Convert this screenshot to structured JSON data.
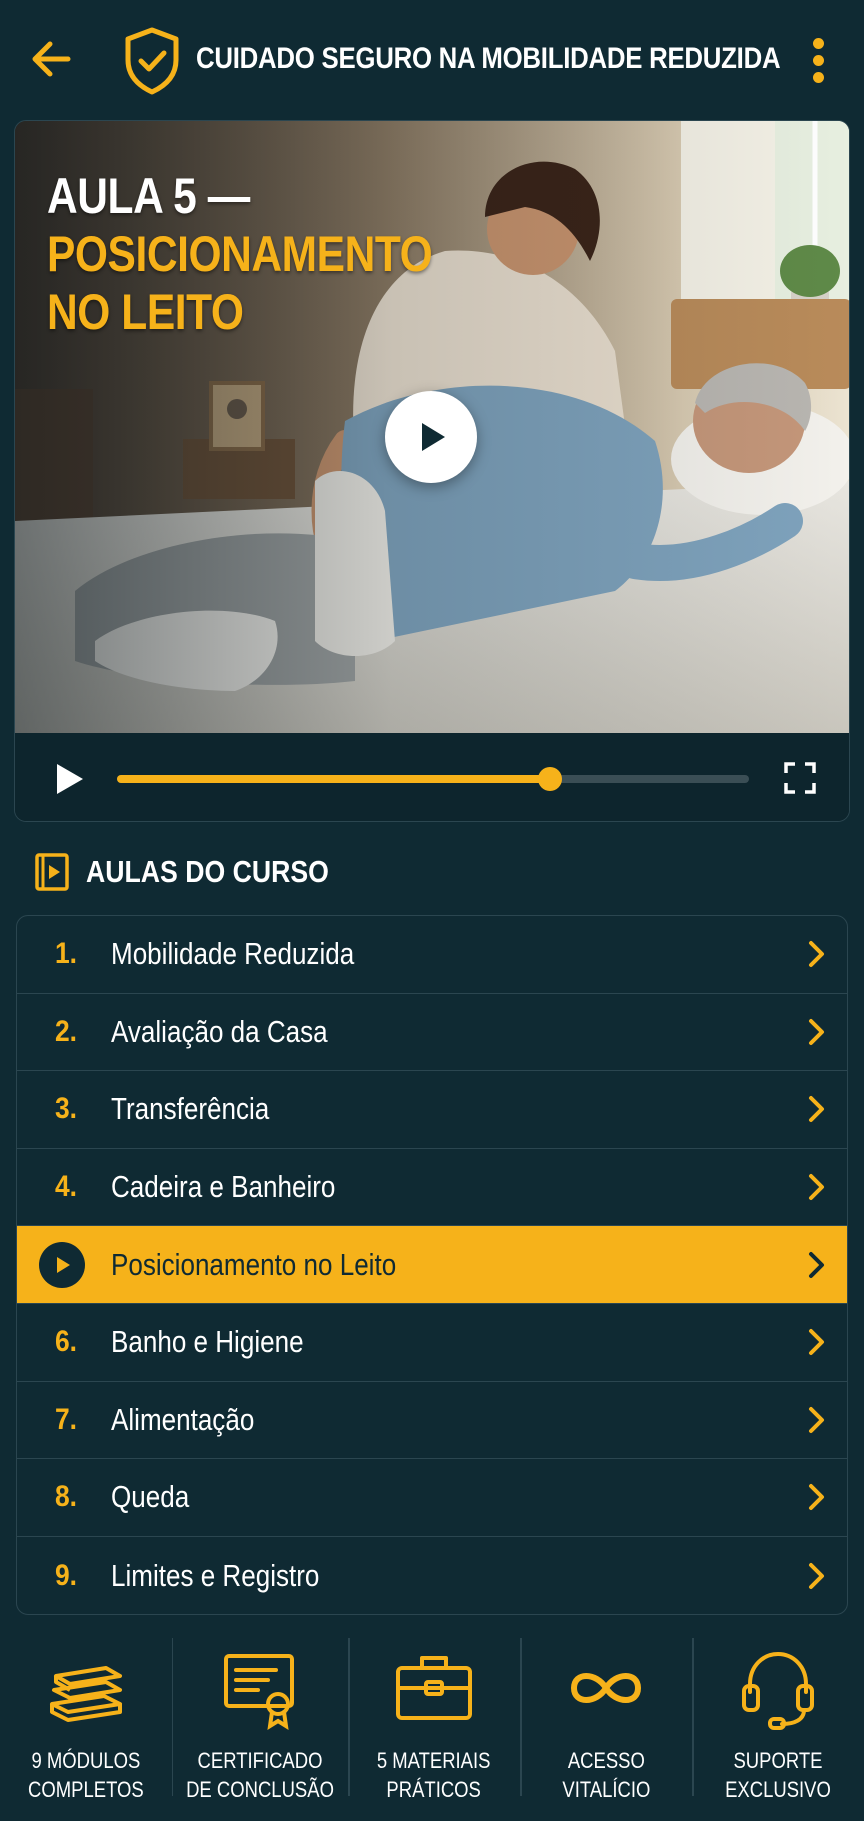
{
  "header": {
    "title": "CUIDADO SEGURO NA MOBILIDADE REDUZIDA",
    "back_icon": "arrow-left-icon",
    "brand_icon": "shield-check-icon",
    "menu_icon": "kebab-menu-icon"
  },
  "video": {
    "title_line1": "AULA 5 —",
    "title_line2": "POSICIONAMENTO",
    "title_line3": "NO LEITO",
    "progress": 0.685
  },
  "section": {
    "title": "AULAS DO CURSO",
    "icon": "play-book-icon"
  },
  "lessons": [
    {
      "num": "1.",
      "label": "Mobilidade Reduzida",
      "active": false
    },
    {
      "num": "2.",
      "label": "Avaliação da Casa",
      "active": false
    },
    {
      "num": "3.",
      "label": "Transferência",
      "active": false
    },
    {
      "num": "4.",
      "label": "Cadeira e Banheiro",
      "active": false
    },
    {
      "num": "",
      "label": "Posicionamento no Leito",
      "active": true
    },
    {
      "num": "6.",
      "label": "Banho e Higiene",
      "active": false
    },
    {
      "num": "7.",
      "label": "Alimentação",
      "active": false
    },
    {
      "num": "8.",
      "label": "Queda",
      "active": false
    },
    {
      "num": "9.",
      "label": "Limites e Registro",
      "active": false
    }
  ],
  "features": [
    {
      "line1": "9 MÓDULOS",
      "line2": "COMPLETOS",
      "icon": "books-icon"
    },
    {
      "line1": "CERTIFICADO",
      "line2": "DE CONCLUSÃO",
      "icon": "certificate-icon"
    },
    {
      "line1": "5 MATERIAIS",
      "line2": "PRÁTICOS",
      "icon": "toolbox-icon"
    },
    {
      "line1": "ACESSO",
      "line2": "VITALÍCIO",
      "icon": "infinity-icon"
    },
    {
      "line1": "SUPORTE",
      "line2": "EXCLUSIVO",
      "icon": "headset-icon"
    }
  ],
  "colors": {
    "background": "#0f2a33",
    "accent": "#f6b21a",
    "border": "#2b4650"
  }
}
